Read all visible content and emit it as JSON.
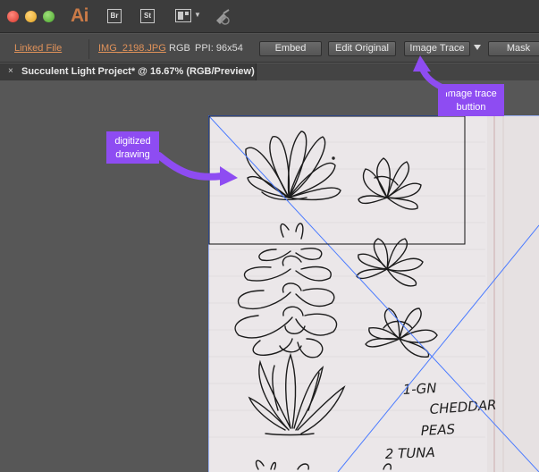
{
  "titlebar": {
    "app_logo": "Ai",
    "bridge_label": "Br",
    "stock_label": "St",
    "icons": [
      "close-window",
      "minimize-window",
      "zoom-window",
      "arrange-documents",
      "sync-settings"
    ]
  },
  "controlbar": {
    "linked_file": "Linked File",
    "filename": "IMG_2198.JPG",
    "color_mode": "RGB",
    "ppi": "PPI: 96x54",
    "embed_label": "Embed",
    "edit_original_label": "Edit Original",
    "image_trace_label": "Image Trace",
    "mask_label": "Mask"
  },
  "document": {
    "tab_close": "×",
    "tab_title": "Succulent Light Project* @ 16.67% (RGB/Preview)"
  },
  "annotations": {
    "drawing_callout": "digitized drawing",
    "trace_callout": "image trace buttion",
    "callout_color": "#8e4cf2"
  },
  "sketch_notes": {
    "line1": "1-GN",
    "line2": "CHEDDAR",
    "line3": "PEAS",
    "line4": "2  TUNA"
  },
  "colors": {
    "accent_link": "#e0925a",
    "selection_blue": "#4b7bff"
  }
}
